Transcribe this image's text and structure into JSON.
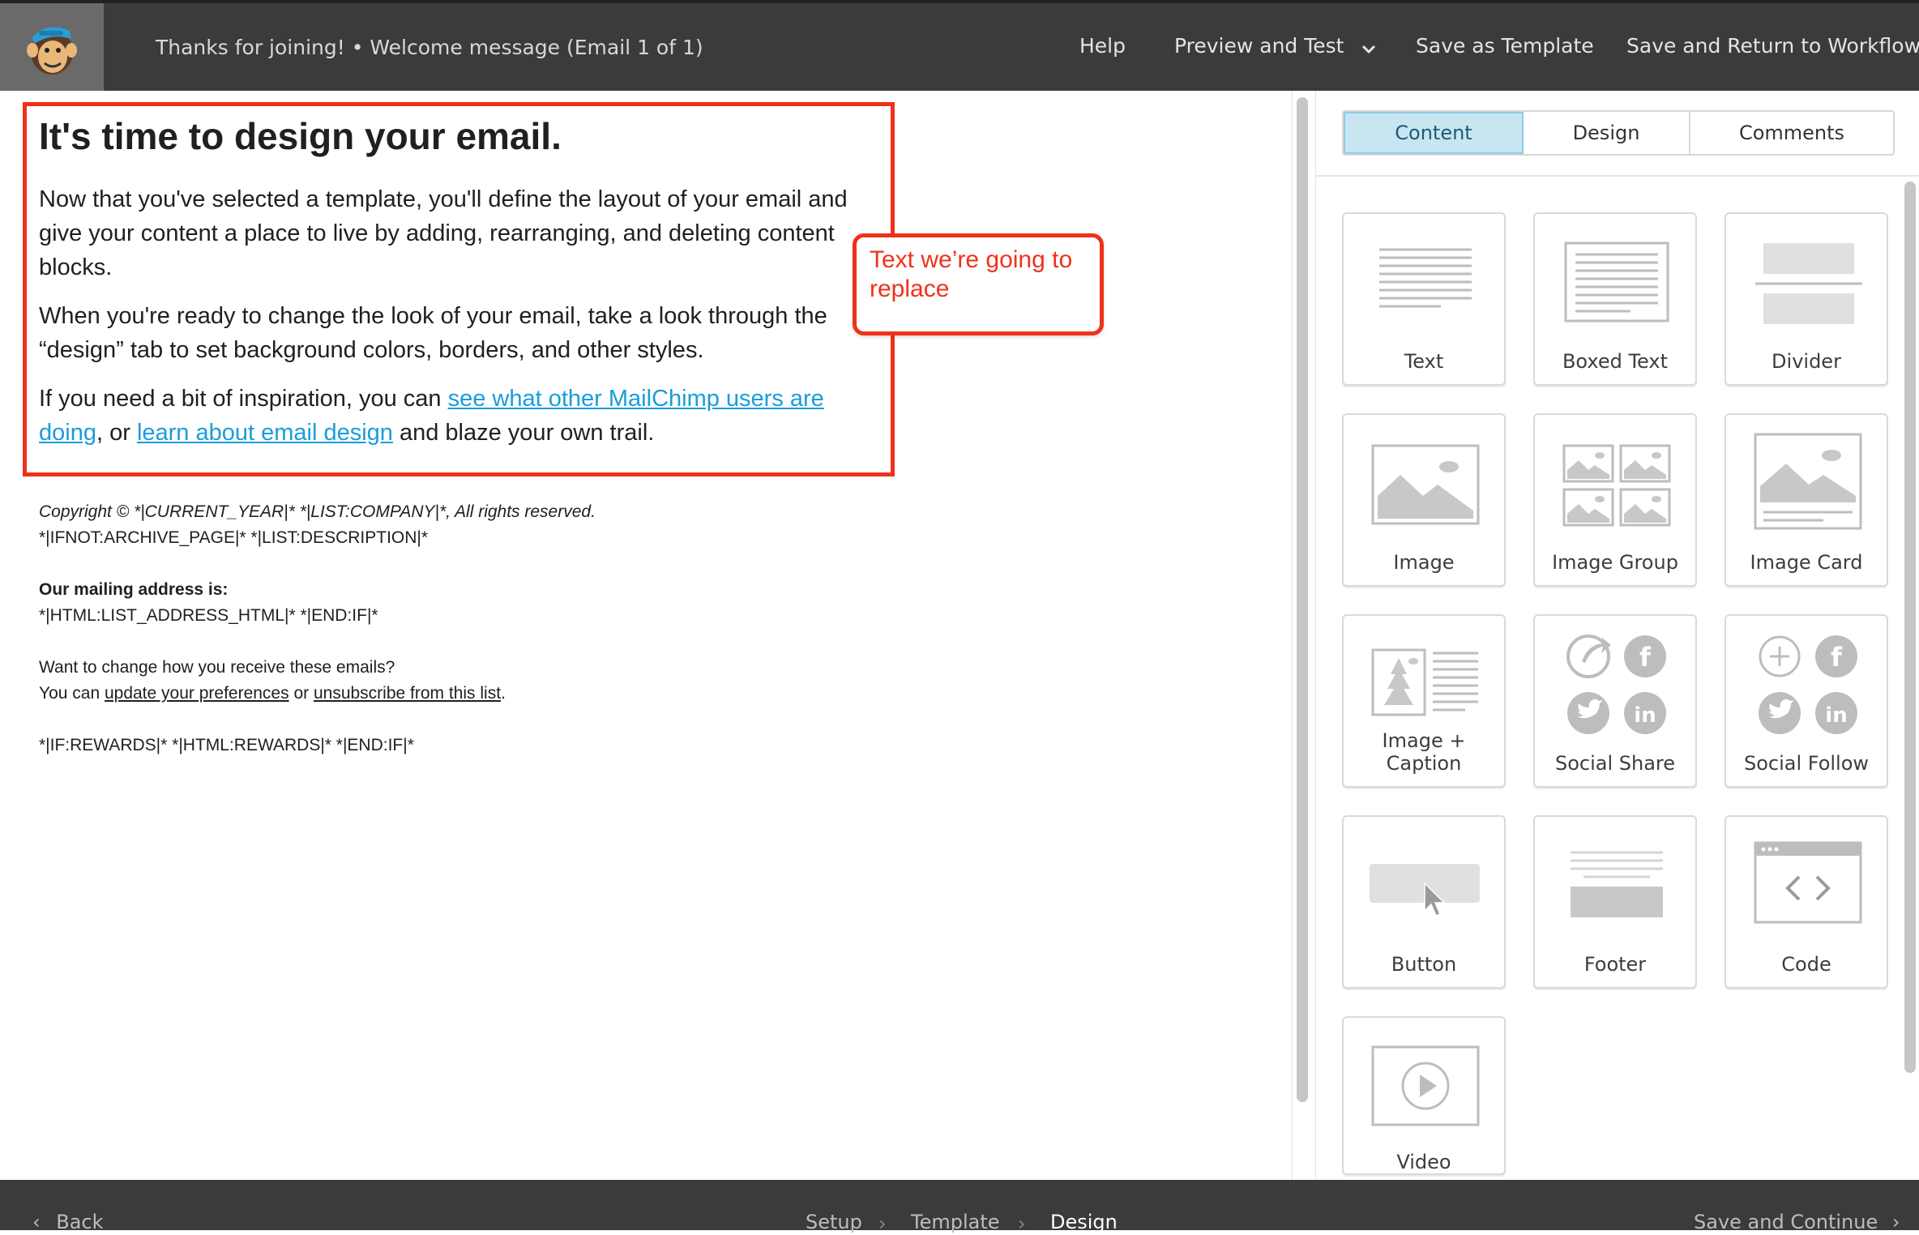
{
  "header": {
    "campaign_title": "Thanks for joining! • Welcome message (Email 1 of 1)",
    "nav": {
      "help": "Help",
      "preview_and_test": "Preview and Test",
      "save_as_template": "Save as Template",
      "save_and_return": "Save and Return to Workflow"
    }
  },
  "email": {
    "heading": "It's time to design your email.",
    "p1": "Now that you've selected a template, you'll define the layout of your email and give your content a place to live by adding, rearranging, and deleting content blocks.",
    "p2": "When you're ready to change the look of your email, take a look through the “design” tab to set background colors, borders, and other styles.",
    "p3_before": "If you need a bit of inspiration, you can ",
    "p3_link1": "see what other MailChimp users are doing",
    "p3_mid": ", or ",
    "p3_link2": "learn about email design",
    "p3_after": " and blaze your own trail."
  },
  "annotation": {
    "callout_text": "Text we’re going to replace",
    "color": "#f0311b"
  },
  "footer": {
    "copyright": "Copyright © *|CURRENT_YEAR|* *|LIST:COMPANY|*, All rights reserved.",
    "archive": "*|IFNOT:ARCHIVE_PAGE|* *|LIST:DESCRIPTION|*",
    "mailing_label": "Our mailing address is:",
    "mailing_value": "*|HTML:LIST_ADDRESS_HTML|* *|END:IF|*",
    "change_q": "Want to change how you receive these emails?",
    "you_can": "You can ",
    "update_link": "update your preferences",
    "or": " or ",
    "unsubscribe_link": "unsubscribe from this list",
    "period": ".",
    "rewards": "*|IF:REWARDS|* *|HTML:REWARDS|* *|END:IF|*"
  },
  "panel": {
    "tabs": [
      "Content",
      "Design",
      "Comments"
    ],
    "active_tab": "Content",
    "blocks": [
      {
        "label": "Text",
        "icon": "text-block-icon"
      },
      {
        "label": "Boxed Text",
        "icon": "boxed-text-block-icon"
      },
      {
        "label": "Divider",
        "icon": "divider-block-icon"
      },
      {
        "label": "Image",
        "icon": "image-block-icon"
      },
      {
        "label": "Image Group",
        "icon": "image-group-block-icon"
      },
      {
        "label": "Image Card",
        "icon": "image-card-block-icon"
      },
      {
        "label": "Image + Caption",
        "icon": "image-caption-block-icon"
      },
      {
        "label": "Social Share",
        "icon": "social-share-block-icon"
      },
      {
        "label": "Social Follow",
        "icon": "social-follow-block-icon"
      },
      {
        "label": "Button",
        "icon": "button-block-icon"
      },
      {
        "label": "Footer",
        "icon": "footer-block-icon"
      },
      {
        "label": "Code",
        "icon": "code-block-icon"
      },
      {
        "label": "Video",
        "icon": "video-block-icon"
      }
    ]
  },
  "bottom": {
    "back": "Back",
    "steps": [
      "Setup",
      "Template",
      "Design"
    ],
    "current_step": "Design",
    "save_continue": "Save and Continue"
  },
  "colors": {
    "topbar": "#3b3b3b",
    "link": "#1a9dd9",
    "active_tab": "#c8e6f2",
    "icon_gray": "#bdbdbd"
  }
}
